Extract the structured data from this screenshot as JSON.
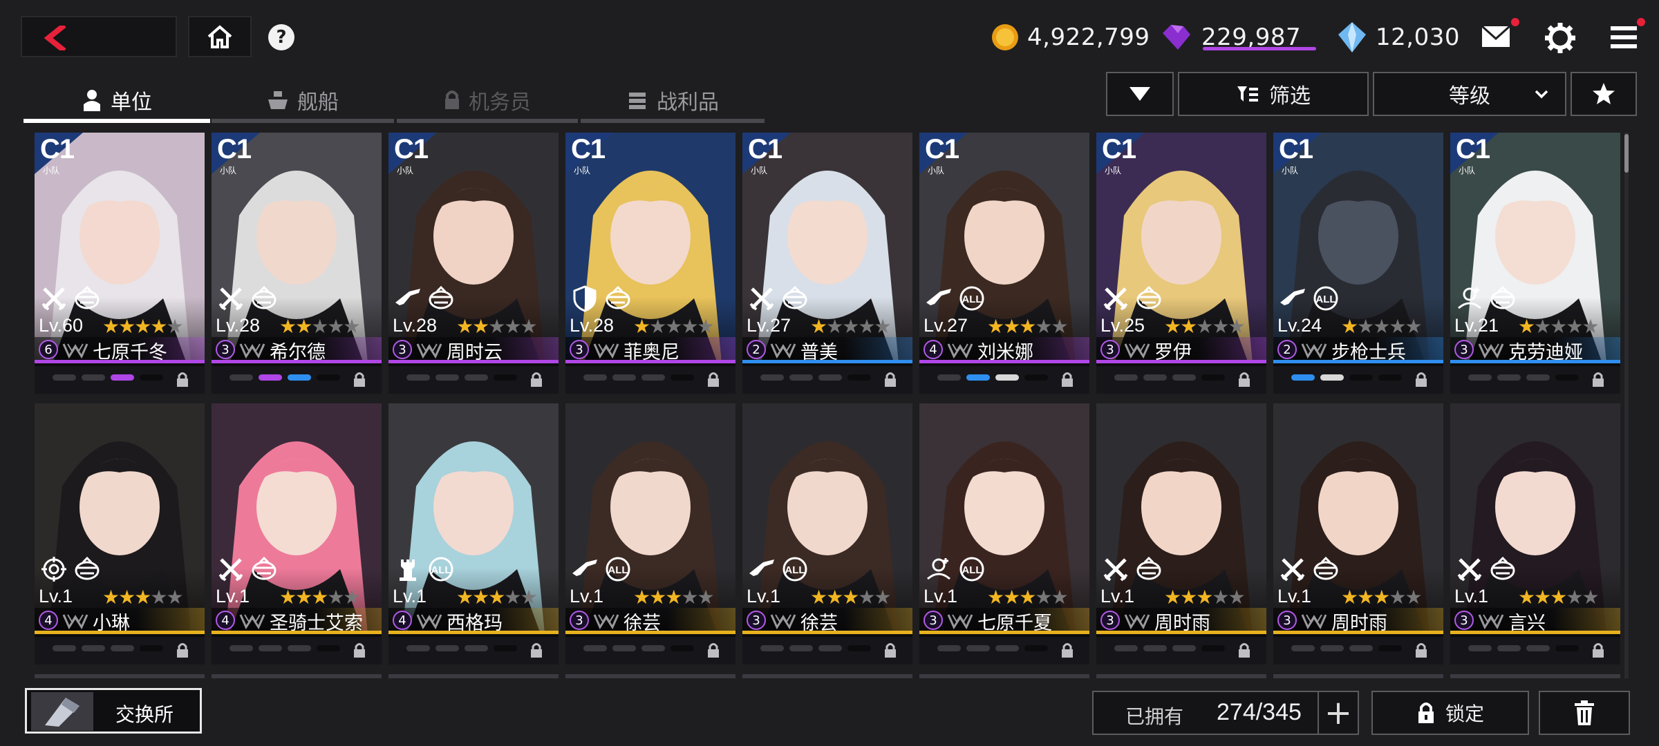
{
  "currencies": {
    "gold": "4,922,799",
    "gem": "229,987",
    "crystal": "12,030"
  },
  "tabs": [
    {
      "label": "单位",
      "state": "active"
    },
    {
      "label": "舰船",
      "state": "normal"
    },
    {
      "label": "机务员",
      "state": "locked"
    },
    {
      "label": "战利品",
      "state": "normal"
    }
  ],
  "controls": {
    "filter_label": "筛选",
    "sort_label": "等级"
  },
  "colors": {
    "rarity_purple": "#b146e6",
    "rarity_blue": "#2f8ff0",
    "rarity_gold": "#e8b21e",
    "star_on": "#f2b623",
    "notification": "#e8213a"
  },
  "cards": [
    {
      "class": "C1",
      "class_sub": "小队",
      "level": "Lv.60",
      "stars": 4,
      "cost": "6",
      "name": "七原千冬",
      "rarity": "purple",
      "hair": "#e8e4ea",
      "bg": "#c9b9c8",
      "skin": "#f3d9cf",
      "pips": [
        "g",
        "g",
        "p",
        "d"
      ],
      "icons": [
        "swords",
        "wing"
      ]
    },
    {
      "class": "C1",
      "class_sub": "小队",
      "level": "Lv.28",
      "stars": 2,
      "cost": "3",
      "name": "希尔德",
      "rarity": "purple",
      "hair": "#dcdcdc",
      "bg": "#4a4a50",
      "skin": "#f1d8cc",
      "pips": [
        "g",
        "p",
        "b",
        "d"
      ],
      "icons": [
        "swords",
        "wing"
      ]
    },
    {
      "class": "C1",
      "class_sub": "小队",
      "level": "Lv.28",
      "stars": 2,
      "cost": "3",
      "name": "周时云",
      "rarity": "purple",
      "hair": "#3a2822",
      "bg": "#303034",
      "skin": "#f0d3c4",
      "pips": [
        "g",
        "g",
        "g",
        "d"
      ],
      "icons": [
        "rifle",
        "wing"
      ]
    },
    {
      "class": "C1",
      "class_sub": "小队",
      "level": "Lv.28",
      "stars": 1,
      "cost": "3",
      "name": "菲奥尼",
      "rarity": "purple",
      "hair": "#e8c25a",
      "bg": "#1f3a6a",
      "skin": "#f3d9cc",
      "pips": [
        "g",
        "g",
        "g",
        "d"
      ],
      "icons": [
        "shield",
        "wing"
      ]
    },
    {
      "class": "C1",
      "class_sub": "小队",
      "level": "Lv.27",
      "stars": 1,
      "cost": "2",
      "name": "普美",
      "rarity": "blue",
      "hair": "#d8dfe8",
      "bg": "#3a3438",
      "skin": "#f3dbd0",
      "pips": [
        "g",
        "g",
        "g",
        "d"
      ],
      "icons": [
        "swords",
        "wing"
      ]
    },
    {
      "class": "C1",
      "class_sub": "小队",
      "level": "Lv.27",
      "stars": 3,
      "cost": "4",
      "name": "刘米娜",
      "rarity": "purple",
      "hair": "#3c2a22",
      "bg": "#3a3a40",
      "skin": "#f1d6c8",
      "pips": [
        "g",
        "b",
        "w",
        "d"
      ],
      "icons": [
        "rifle",
        "all"
      ]
    },
    {
      "class": "C1",
      "class_sub": "小队",
      "level": "Lv.25",
      "stars": 2,
      "cost": "3",
      "name": "罗伊",
      "rarity": "purple",
      "hair": "#e8c87a",
      "bg": "#3c2c54",
      "skin": "#f1d6c8",
      "pips": [
        "g",
        "g",
        "g",
        "d"
      ],
      "icons": [
        "swords",
        "wing"
      ]
    },
    {
      "class": "C1",
      "class_sub": "小队",
      "level": "Lv.24",
      "stars": 1,
      "cost": "2",
      "name": "步枪士兵",
      "rarity": "blue",
      "hair": "#2a2c34",
      "bg": "#2a3a50",
      "skin": "#4a5260",
      "pips": [
        "b",
        "w",
        "d",
        "d"
      ],
      "icons": [
        "rifle",
        "all"
      ]
    },
    {
      "class": "C1",
      "class_sub": "小队",
      "level": "Lv.21",
      "stars": 1,
      "cost": "3",
      "name": "克劳迪娅",
      "rarity": "blue",
      "hair": "#eef0f2",
      "bg": "#3a4a48",
      "skin": "#f4ddd2",
      "pips": [
        "g",
        "g",
        "g",
        "d"
      ],
      "icons": [
        "support",
        "wing"
      ]
    },
    {
      "class": "",
      "class_sub": "",
      "level": "Lv.1",
      "stars": 3,
      "cost": "4",
      "name": "小琳",
      "rarity": "gold",
      "hair": "#1c1a1c",
      "bg": "#2c2a28",
      "skin": "#f1d8cc",
      "pips": [
        "g",
        "g",
        "g",
        "d"
      ],
      "icons": [
        "target",
        "wing"
      ]
    },
    {
      "class": "",
      "class_sub": "",
      "level": "Lv.1",
      "stars": 3,
      "cost": "4",
      "name": "圣骑士艾索",
      "rarity": "gold",
      "hair": "#ee7a9a",
      "bg": "#3c2a3a",
      "skin": "#f4dcd2",
      "pips": [
        "g",
        "g",
        "g",
        "d"
      ],
      "icons": [
        "swords",
        "wing"
      ]
    },
    {
      "class": "",
      "class_sub": "",
      "level": "Lv.1",
      "stars": 3,
      "cost": "4",
      "name": "西格玛",
      "rarity": "gold",
      "hair": "#a8d2dc",
      "bg": "#3a3a3e",
      "skin": "#f2dad0",
      "pips": [
        "g",
        "g",
        "g",
        "d"
      ],
      "icons": [
        "tower",
        "all"
      ]
    },
    {
      "class": "",
      "class_sub": "",
      "level": "Lv.1",
      "stars": 3,
      "cost": "3",
      "name": "徐芸",
      "rarity": "gold",
      "hair": "#3c2a24",
      "bg": "#2c2c30",
      "skin": "#f1d8cc",
      "pips": [
        "g",
        "g",
        "g",
        "d"
      ],
      "icons": [
        "rifle",
        "all"
      ]
    },
    {
      "class": "",
      "class_sub": "",
      "level": "Lv.1",
      "stars": 3,
      "cost": "3",
      "name": "徐芸",
      "rarity": "gold",
      "hair": "#3c2a24",
      "bg": "#2c2c30",
      "skin": "#f1d8cc",
      "pips": [
        "g",
        "g",
        "g",
        "d"
      ],
      "icons": [
        "rifle",
        "all"
      ]
    },
    {
      "class": "",
      "class_sub": "",
      "level": "Lv.1",
      "stars": 3,
      "cost": "3",
      "name": "七原千夏",
      "rarity": "gold",
      "hair": "#3a2420",
      "bg": "#3a3236",
      "skin": "#f3dbd0",
      "pips": [
        "g",
        "g",
        "g",
        "d"
      ],
      "icons": [
        "support",
        "all"
      ]
    },
    {
      "class": "",
      "class_sub": "",
      "level": "Lv.1",
      "stars": 3,
      "cost": "3",
      "name": "周时雨",
      "rarity": "gold",
      "hair": "#2c1e1a",
      "bg": "#2e2e32",
      "skin": "#f1d6c8",
      "pips": [
        "g",
        "g",
        "g",
        "d"
      ],
      "icons": [
        "swords",
        "wing"
      ]
    },
    {
      "class": "",
      "class_sub": "",
      "level": "Lv.1",
      "stars": 3,
      "cost": "3",
      "name": "周时雨",
      "rarity": "gold",
      "hair": "#2c1e1a",
      "bg": "#2e2e32",
      "skin": "#f1d6c8",
      "pips": [
        "g",
        "g",
        "g",
        "d"
      ],
      "icons": [
        "swords",
        "wing"
      ]
    },
    {
      "class": "",
      "class_sub": "",
      "level": "Lv.1",
      "stars": 3,
      "cost": "3",
      "name": "言兴",
      "rarity": "gold",
      "hair": "#241a22",
      "bg": "#2c2a2e",
      "skin": "#f3dad0",
      "pips": [
        "g",
        "g",
        "g",
        "d"
      ],
      "icons": [
        "swords",
        "wing"
      ]
    }
  ],
  "bottom": {
    "exchange_label": "交换所",
    "owned_label": "已拥有",
    "owned_count": "274/345",
    "plus_label": "+",
    "lock_label": "锁定"
  }
}
